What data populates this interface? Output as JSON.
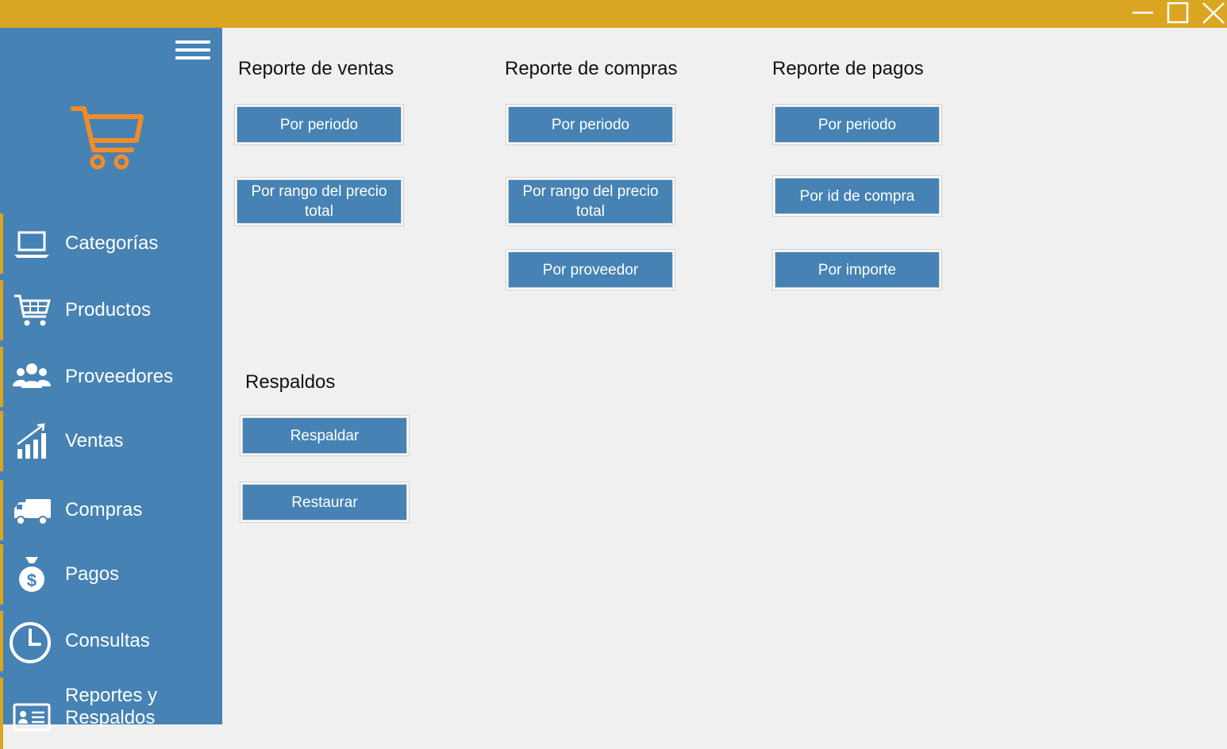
{
  "window": {
    "controls": [
      {
        "name": "minimize-icon"
      },
      {
        "name": "maximize-icon"
      },
      {
        "name": "close-icon"
      }
    ]
  },
  "colors": {
    "titlebar": "#daa520",
    "sidebar": "#4682b4",
    "accent": "#daa520",
    "button": "#4682b4",
    "logo": "#f28c28",
    "content_bg": "#f0f0f0"
  },
  "sidebar": {
    "menu_icon": "hamburger-menu-icon",
    "logo_icon": "shopping-cart-icon",
    "items": [
      {
        "label": "Categorías",
        "icon": "laptop-icon"
      },
      {
        "label": "Productos",
        "icon": "cart-icon"
      },
      {
        "label": "Proveedores",
        "icon": "users-icon"
      },
      {
        "label": "Ventas",
        "icon": "bar-chart-icon"
      },
      {
        "label": "Compras",
        "icon": "truck-icon"
      },
      {
        "label": "Pagos",
        "icon": "money-bag-icon"
      },
      {
        "label": "Consultas",
        "icon": "clock-icon"
      },
      {
        "label": "Reportes y Respaldos",
        "icon": "id-card-icon"
      }
    ]
  },
  "reports": {
    "ventas": {
      "title": "Reporte de ventas",
      "buttons": [
        "Por periodo",
        "Por rango del precio total"
      ]
    },
    "compras": {
      "title": "Reporte de compras",
      "buttons": [
        "Por periodo",
        "Por rango del precio total",
        "Por proveedor"
      ]
    },
    "pagos": {
      "title": "Reporte de pagos",
      "buttons": [
        "Por periodo",
        "Por id de compra",
        "Por importe"
      ]
    }
  },
  "respaldos": {
    "title": "Respaldos",
    "buttons": [
      "Respaldar",
      "Restaurar"
    ]
  }
}
